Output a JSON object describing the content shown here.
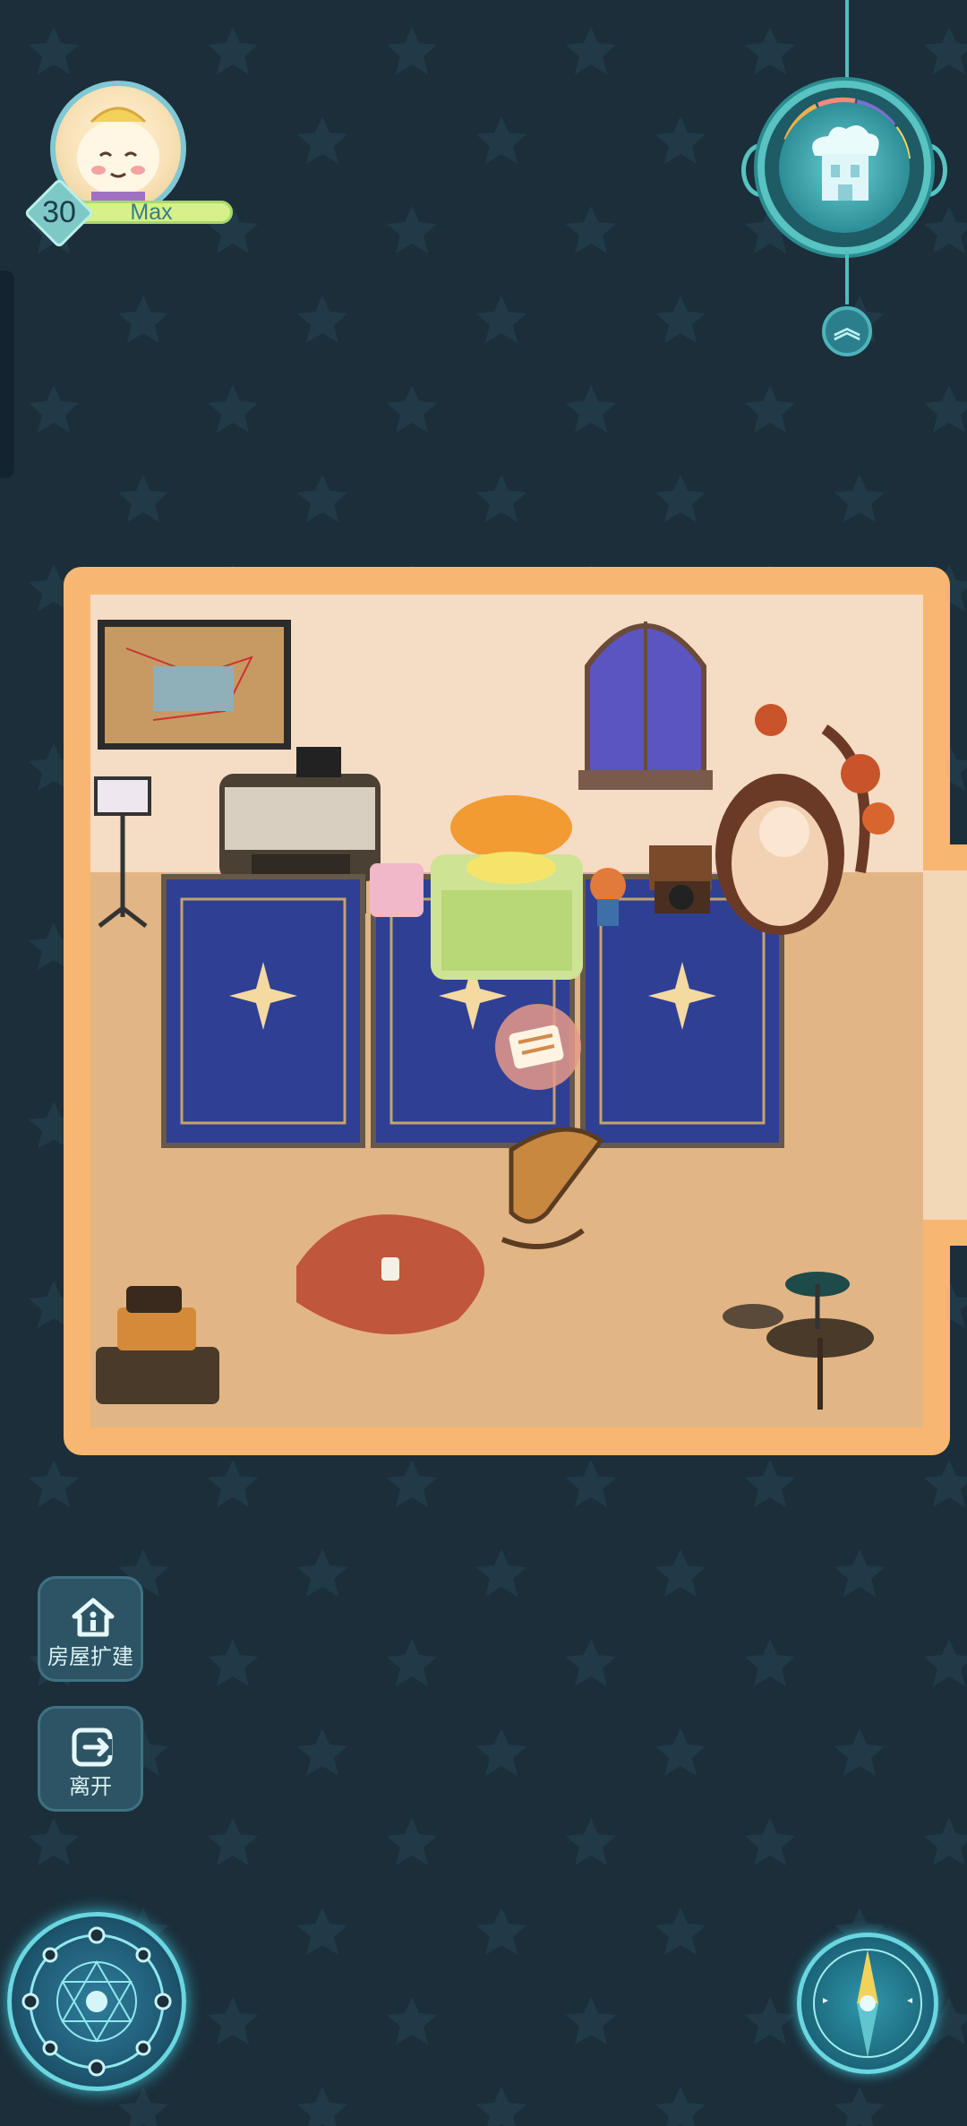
{
  "player": {
    "level": "30",
    "exp_label": "Max",
    "avatar_icon": "cat-avatar-icon"
  },
  "weather_dial": {
    "icon": "room-building-icon",
    "expand_icon": "double-chevron-up-icon"
  },
  "side_buttons": [
    {
      "label": "房屋扩建",
      "icon": "house-info-icon"
    },
    {
      "label": "离开",
      "icon": "exit-icon"
    }
  ],
  "bottom": {
    "left_icon": "magic-circle-icon",
    "right_icon": "compass-icon"
  },
  "room": {
    "task_bubble_icon": "note-bubble-icon"
  },
  "colors": {
    "background": "#1b2e3a",
    "frame": "#f7b772",
    "accent": "#58c3c1"
  }
}
